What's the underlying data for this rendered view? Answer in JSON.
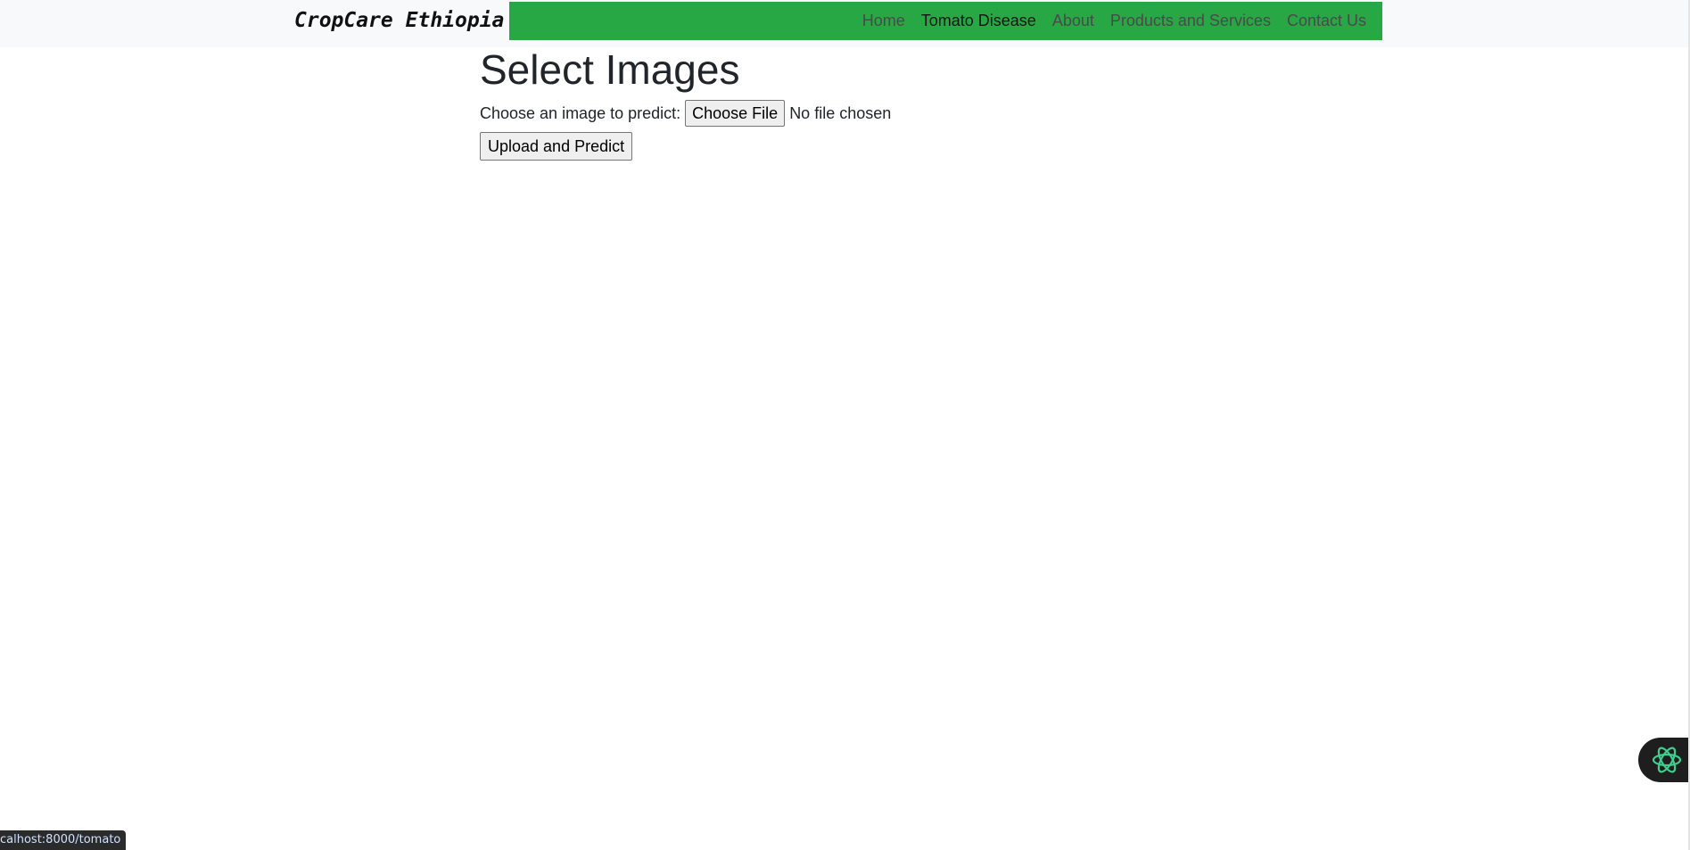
{
  "header": {
    "brand": "CropCare Ethiopia",
    "nav": [
      {
        "label": "Home",
        "active": false
      },
      {
        "label": "Tomato Disease",
        "active": true
      },
      {
        "label": "About",
        "active": false
      },
      {
        "label": "Products and Services",
        "active": false
      },
      {
        "label": "Contact Us",
        "active": false
      }
    ]
  },
  "main": {
    "title": "Select Images",
    "file_label": "Choose an image to predict:",
    "choose_button": "Choose File",
    "file_status": "No file chosen",
    "submit_button": "Upload and Predict"
  },
  "status_bar": {
    "url": "calhost:8000/tomato"
  },
  "colors": {
    "navbar_bg": "#28a745",
    "topbar_bg": "#f8f9fa"
  },
  "icons": {
    "assistant": "atom-icon"
  }
}
